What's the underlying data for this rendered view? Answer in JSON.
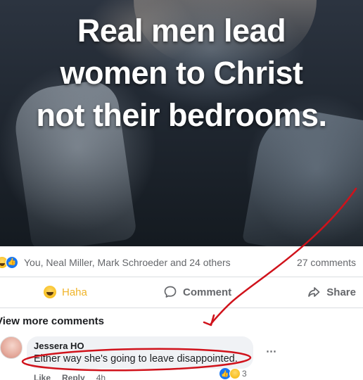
{
  "post": {
    "image_text_lines": [
      "Real men lead",
      "women to Christ",
      "not their bedrooms."
    ]
  },
  "reactions": {
    "names": "You, Neal Miller, Mark Schroeder and 24 others",
    "comment_count": "27 comments",
    "icons": [
      "haha-icon",
      "like-icon"
    ]
  },
  "actions": {
    "haha_label": "Haha",
    "comment_label": "Comment",
    "share_label": "Share"
  },
  "comments": {
    "view_more": "View more comments",
    "items": [
      {
        "name": "Jessera HO",
        "text": "Either way she's going to leave disappointed.",
        "reaction_count": "3",
        "like_label": "Like",
        "reply_label": "Reply",
        "time": "4h"
      }
    ]
  },
  "colors": {
    "annotation_red": "#d0121b",
    "facebook_blue": "#1877f2",
    "haha_yellow": "#f0b429"
  }
}
